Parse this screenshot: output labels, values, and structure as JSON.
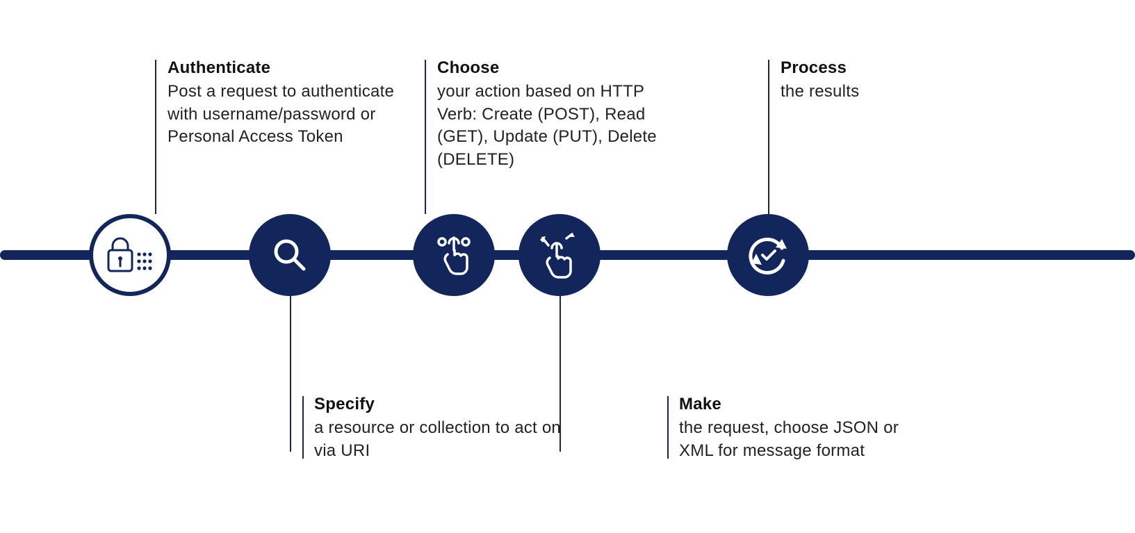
{
  "colors": {
    "accent": "#12265c",
    "background": "#ffffff",
    "text": "#1a1a1a"
  },
  "steps": [
    {
      "icon": "lock-keypad-icon",
      "title": "Authenticate",
      "desc": "Post a request to authenticate with username/password or Personal Access Token",
      "position": "top"
    },
    {
      "icon": "search-icon",
      "title": "Specify",
      "desc": "a resource or collection to act on via URI",
      "position": "bottom"
    },
    {
      "icon": "tap-select-icon",
      "title": "Choose",
      "desc": "your action based on HTTP Verb: Create (POST), Read (GET), Update (PUT), Delete (DELETE)",
      "position": "top"
    },
    {
      "icon": "swipe-gesture-icon",
      "title": "Make",
      "desc": "the request, choose JSON or XML for message format",
      "position": "bottom"
    },
    {
      "icon": "refresh-check-icon",
      "title": "Process",
      "desc": "the results",
      "position": "top"
    }
  ]
}
